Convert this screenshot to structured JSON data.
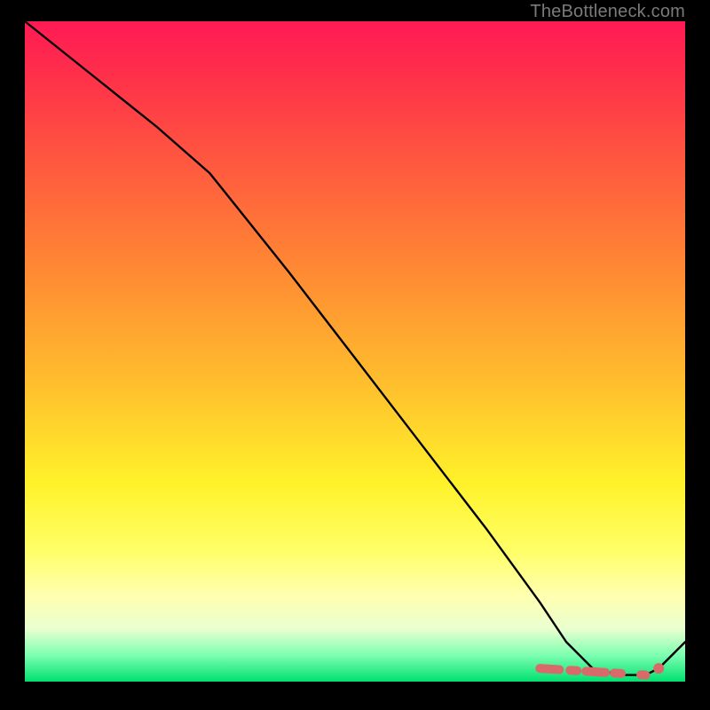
{
  "watermark": "TheBottleneck.com",
  "chart_data": {
    "type": "line",
    "title": "",
    "xlabel": "",
    "ylabel": "",
    "xlim": [
      0,
      100
    ],
    "ylim": [
      0,
      100
    ],
    "series": [
      {
        "name": "main-curve",
        "color": "#000000",
        "x": [
          0,
          10,
          20,
          28,
          40,
          50,
          60,
          70,
          78,
          82,
          86,
          90,
          94,
          96,
          100
        ],
        "y": [
          100,
          92,
          84,
          77,
          62,
          49,
          36,
          23,
          12,
          6,
          2,
          1,
          1,
          2,
          6
        ]
      }
    ],
    "highlight": {
      "name": "flat-segment-marker",
      "color": "#d96a6a",
      "x": [
        78,
        94
      ],
      "y": [
        2,
        1
      ],
      "endpoint": {
        "x": 96,
        "y": 2
      }
    }
  }
}
